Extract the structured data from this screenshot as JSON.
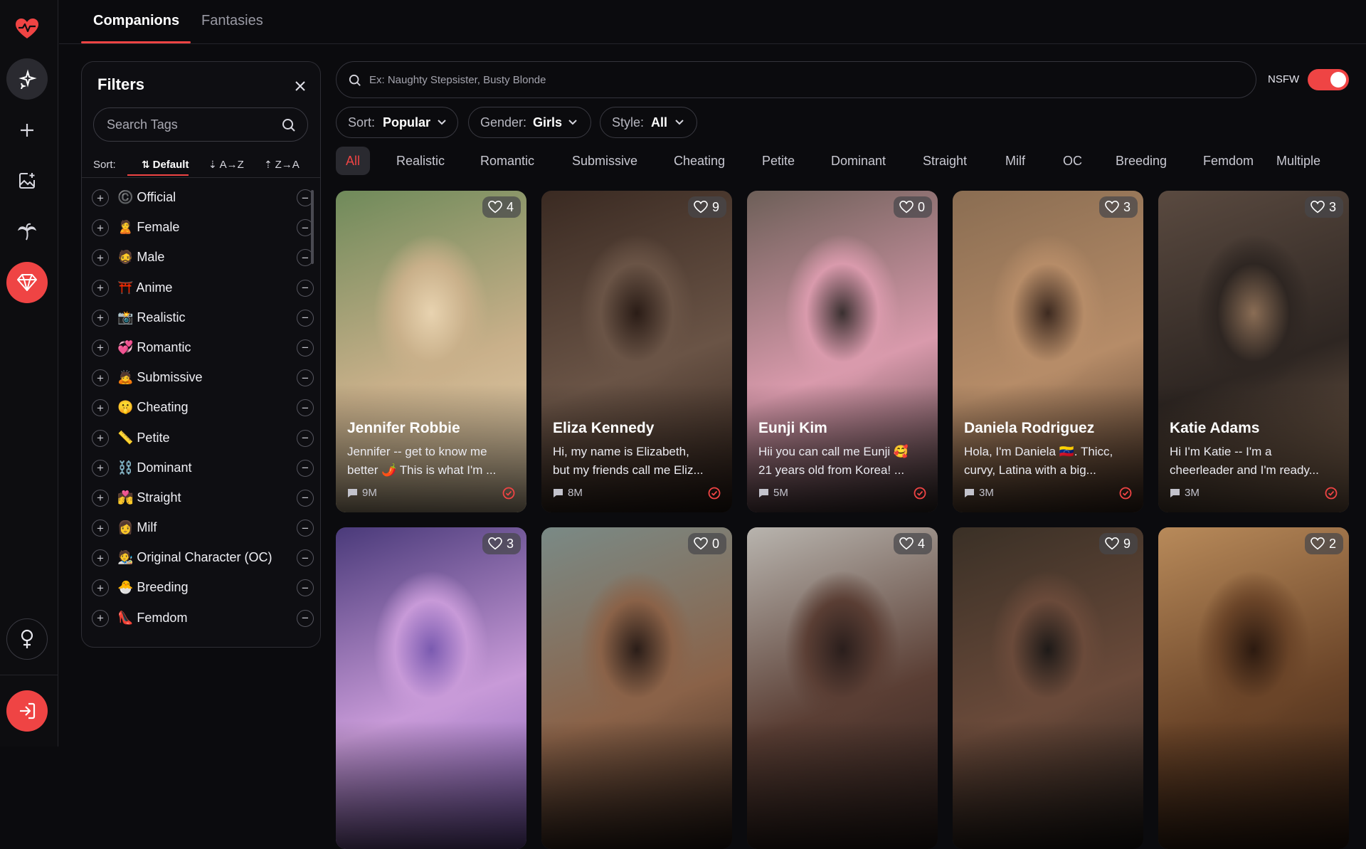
{
  "nav": {
    "tabs": [
      {
        "label": "Companions",
        "active": true
      },
      {
        "label": "Fantasies",
        "active": false
      }
    ]
  },
  "rail": {
    "icons": [
      "heart-pulse-icon",
      "sparkles-icon",
      "plus-icon",
      "image-add-icon",
      "palm-tree-icon",
      "gem-icon",
      "female-icon",
      "login-icon"
    ]
  },
  "filters": {
    "title": "Filters",
    "search_placeholder": "Search Tags",
    "sort_label": "Sort:",
    "sort_options": [
      "Default",
      "A→Z",
      "Z→A"
    ],
    "sort_selected": "Default",
    "tags": [
      {
        "emoji": "©️",
        "label": "Official"
      },
      {
        "emoji": "🙎",
        "label": "Female"
      },
      {
        "emoji": "🧔",
        "label": "Male"
      },
      {
        "emoji": "⛩️",
        "label": "Anime"
      },
      {
        "emoji": "📸",
        "label": "Realistic"
      },
      {
        "emoji": "💞",
        "label": "Romantic"
      },
      {
        "emoji": "🙇",
        "label": "Submissive"
      },
      {
        "emoji": "🤫",
        "label": "Cheating"
      },
      {
        "emoji": "📏",
        "label": "Petite"
      },
      {
        "emoji": "⛓️",
        "label": "Dominant"
      },
      {
        "emoji": "💏",
        "label": "Straight"
      },
      {
        "emoji": "👩",
        "label": "Milf"
      },
      {
        "emoji": "🧑‍🎨",
        "label": "Original Character (OC)"
      },
      {
        "emoji": "🐣",
        "label": "Breeding"
      },
      {
        "emoji": "👠",
        "label": "Femdom"
      }
    ]
  },
  "search": {
    "placeholder": "Ex: Naughty Stepsister, Busty Blonde"
  },
  "nsfw": {
    "label": "NSFW",
    "enabled": true
  },
  "dropdowns": [
    {
      "key": "Sort:",
      "value": "Popular"
    },
    {
      "key": "Gender:",
      "value": "Girls"
    },
    {
      "key": "Style:",
      "value": "All"
    }
  ],
  "chips": [
    "All",
    "Realistic",
    "Romantic",
    "Submissive",
    "Cheating",
    "Petite",
    "Dominant",
    "Straight",
    "Milf",
    "OC",
    "Breeding",
    "Femdom",
    "Multiple"
  ],
  "chip_selected": "All",
  "cards": [
    {
      "name": "Jennifer Robbie",
      "desc1": "Jennifer -- get to know me",
      "desc2": "better 🌶️ This is what I'm ...",
      "chats": "9M",
      "likes": "4"
    },
    {
      "name": "Eliza Kennedy",
      "desc1": "Hi, my name is Elizabeth,",
      "desc2": "but my friends call me Eliz...",
      "chats": "8M",
      "likes": "9"
    },
    {
      "name": "Eunji Kim",
      "desc1": "Hii you can call me Eunji 🥰",
      "desc2": "21 years old from Korea! ...",
      "chats": "5M",
      "likes": "0"
    },
    {
      "name": "Daniela Rodriguez",
      "desc1": "Hola, I'm Daniela 🇻🇪. Thicc,",
      "desc2": "curvy, Latina with a big...",
      "chats": "3M",
      "likes": "3"
    },
    {
      "name": "Katie Adams",
      "desc1": "Hi I'm Katie -- I'm a",
      "desc2": "cheerleader and I'm ready...",
      "chats": "3M",
      "likes": "3"
    },
    {
      "likes": "3"
    },
    {
      "likes": "0"
    },
    {
      "likes": "4"
    },
    {
      "likes": "9"
    },
    {
      "likes": "2"
    }
  ],
  "colors": {
    "accent": "#ef4444",
    "background": "#0b0b0e"
  }
}
